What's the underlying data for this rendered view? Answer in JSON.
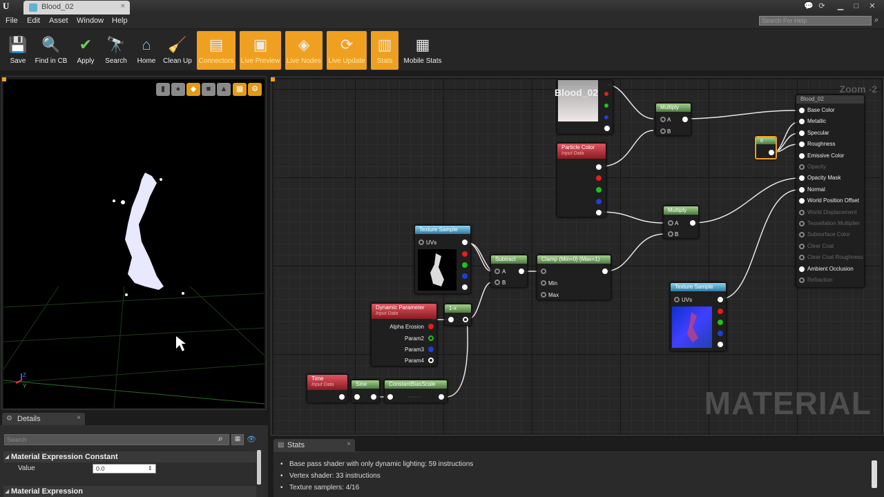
{
  "window": {
    "tab_title": "Blood_02",
    "tab_close": "×"
  },
  "menu": [
    "File",
    "Edit",
    "Asset",
    "Window",
    "Help"
  ],
  "search_help_placeholder": "Search For Help",
  "toolbar": [
    {
      "label": "Save",
      "icon": "💾",
      "active": false
    },
    {
      "label": "Find in CB",
      "icon": "🔍",
      "active": false
    },
    {
      "label": "Apply",
      "icon": "✔",
      "active": false
    },
    {
      "label": "Search",
      "icon": "🔭",
      "active": false
    },
    {
      "label": "Home",
      "icon": "⌂",
      "active": false
    },
    {
      "label": "Clean Up",
      "icon": "🧹",
      "active": false
    },
    {
      "label": "Connectors",
      "icon": "▤",
      "active": true
    },
    {
      "label": "Live Preview",
      "icon": "▣",
      "active": true
    },
    {
      "label": "Live Nodes",
      "icon": "◈",
      "active": true
    },
    {
      "label": "Live Update",
      "icon": "⟳",
      "active": true
    },
    {
      "label": "Stats",
      "icon": "▥",
      "active": true
    },
    {
      "label": "Mobile Stats",
      "icon": "▦",
      "active": false
    }
  ],
  "graph": {
    "zoom": "Zoom -2",
    "watermark": "MATERIAL",
    "preview_title": "Blood_02",
    "nodes": {
      "multiply1": {
        "title": "Multiply",
        "pins": [
          "A",
          "B"
        ]
      },
      "multiply2": {
        "title": "Multiply",
        "pins": [
          "A",
          "B"
        ]
      },
      "particle_color": {
        "title": "Particle Color",
        "subtitle": "Input Data"
      },
      "texture_sample1": {
        "title": "Texture Sample",
        "pin": "UVs"
      },
      "texture_sample2": {
        "title": "Texture Sample",
        "pin": "UVs"
      },
      "subtract": {
        "title": "Subtract",
        "pins": [
          "A",
          "B"
        ]
      },
      "clamp": {
        "title": "Clamp (Min=0) (Max=1)",
        "pins": [
          "Min",
          "Max"
        ]
      },
      "dynamic_param": {
        "title": "Dynamic Parameter",
        "subtitle": "Input Data",
        "pins": [
          "Alpha Erosion",
          "Param2",
          "Param3",
          "Param4"
        ]
      },
      "one_minus": {
        "title": "1-x"
      },
      "time": {
        "title": "Time",
        "subtitle": "Input Data"
      },
      "sine": {
        "title": "Sine"
      },
      "constant_bias": {
        "title": "ConstantBiasScale"
      },
      "constant": {
        "title": "0"
      },
      "result": {
        "title": "Blood_02",
        "pins": [
          {
            "label": "Base Color",
            "enabled": true
          },
          {
            "label": "Metallic",
            "enabled": true
          },
          {
            "label": "Specular",
            "enabled": true
          },
          {
            "label": "Roughness",
            "enabled": true
          },
          {
            "label": "Emissive Color",
            "enabled": true
          },
          {
            "label": "Opacity",
            "enabled": false
          },
          {
            "label": "Opacity Mask",
            "enabled": true
          },
          {
            "label": "Normal",
            "enabled": true
          },
          {
            "label": "World Position Offset",
            "enabled": true
          },
          {
            "label": "World Displacement",
            "enabled": false
          },
          {
            "label": "Tessellation Multiplier",
            "enabled": false
          },
          {
            "label": "Subsurface Color",
            "enabled": false
          },
          {
            "label": "Clear Coat",
            "enabled": false
          },
          {
            "label": "Clear Coat Roughness",
            "enabled": false
          },
          {
            "label": "Ambient Occlusion",
            "enabled": true
          },
          {
            "label": "Refraction",
            "enabled": false
          }
        ]
      }
    }
  },
  "details": {
    "tab": "Details",
    "search_placeholder": "Search",
    "section1": "Material Expression Constant",
    "value_label": "Value",
    "value": "0.0",
    "section2": "Material Expression"
  },
  "stats": {
    "tab": "Stats",
    "lines": [
      "Base pass shader with only dynamic lighting: 59 instructions",
      "Vertex shader: 33 instructions",
      "Texture samplers: 4/16"
    ]
  },
  "viewport_axis": {
    "z": "Z",
    "y": "Y"
  }
}
